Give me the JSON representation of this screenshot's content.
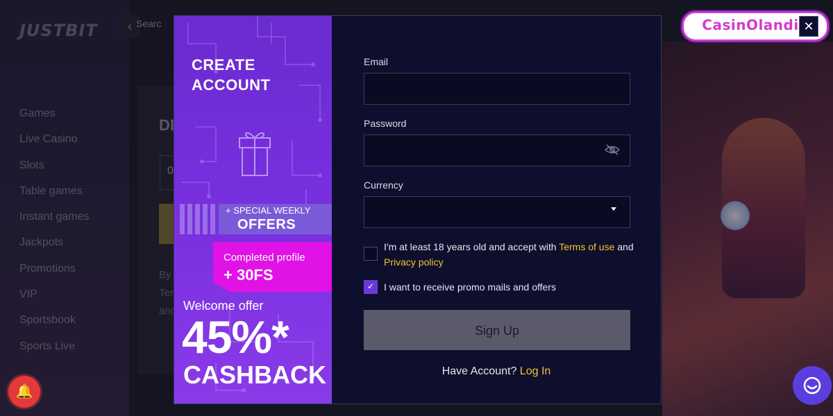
{
  "site": {
    "logo": "JUSTBIT",
    "search_fragment": "Searc",
    "nav": [
      "Games",
      "Live Casino",
      "Slots",
      "Table games",
      "Instant games",
      "Jackpots",
      "Promotions",
      "VIP",
      "Sportsbook",
      "Sports Live"
    ],
    "card_heading_fragment": "DE",
    "card_input_fragment": "0",
    "card_text_lines": [
      "By",
      "Ter",
      "and"
    ]
  },
  "watermark": {
    "brand": "CasinOlandia"
  },
  "modal": {
    "promo": {
      "title_line1": "CREATE",
      "title_line2": "ACCOUNT",
      "weekly_small": "+ SPECIAL WEEKLY",
      "weekly_big": "OFFERS",
      "profile_small": "Completed profile",
      "profile_big": "+ 30FS",
      "welcome": "Welcome offer",
      "percent": "45%*",
      "cashback": "CASHBACK"
    },
    "form": {
      "email_label": "Email",
      "email_value": "",
      "password_label": "Password",
      "password_value": "",
      "currency_label": "Currency",
      "currency_value": "",
      "terms_prefix": "I'm at least 18 years old and accept with ",
      "terms_link": "Terms of use",
      "terms_and": " and",
      "privacy_link": "Privacy policy",
      "terms_checked": false,
      "promo_label": "I want to receive promo mails and offers",
      "promo_checked": true,
      "signup_label": "Sign Up",
      "have_account": "Have Account? ",
      "login_link": "Log In"
    },
    "close_label": "✕"
  },
  "colors": {
    "promo_purple": "#7a30e0",
    "profile_magenta": "#e112e6",
    "link_yellow": "#f2c431",
    "signup_disabled": "#5a5a6a",
    "modal_bg": "#0e0f2c"
  },
  "icons": [
    "chevron-left-icon",
    "gift-icon",
    "eye-slash-icon",
    "caret-down-icon",
    "check-icon",
    "close-icon",
    "bell-icon",
    "chat-icon"
  ]
}
